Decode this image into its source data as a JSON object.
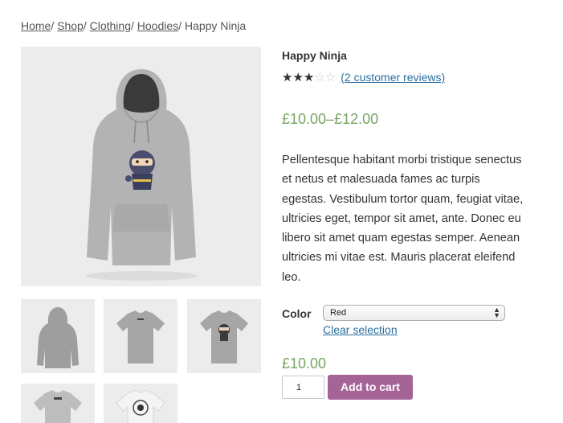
{
  "breadcrumb": {
    "items": [
      "Home",
      "Shop",
      "Clothing",
      "Hoodies"
    ],
    "separator": "/ ",
    "current": "Happy Ninja"
  },
  "product": {
    "title": "Happy Ninja",
    "rating": {
      "value": 3,
      "max": 5,
      "fraction": 0.6
    },
    "reviews_link": "(2 customer reviews)",
    "price_range": "£10.00–£12.00",
    "description": "Pellentesque habitant morbi tristique senectus et netus et malesuada fames ac turpis egestas. Vestibulum tortor quam, feugiat vitae, ultricies eget, tempor sit amet, ante. Donec eu libero sit amet quam egestas semper. Aenean ultricies mi vitae est. Mauris placerat eleifend leo.",
    "color_label": "Color",
    "color_selected": "Red",
    "clear_selection": "Clear selection",
    "variation_price": "£10.00",
    "quantity": "1",
    "add_to_cart": "Add to cart"
  },
  "gallery": {
    "main_image": "gray-hoodie-with-ninja-print",
    "thumbnails": [
      "gray-hoodie-back-view",
      "gray-tshirt-back-view",
      "gray-tshirt-with-ninja-print",
      "gray-tshirt-with-small-logo",
      "white-tshirt-with-ninja-badge"
    ]
  },
  "colors": {
    "price": "#77a464",
    "button": "#a46497",
    "link": "#2a6fa0",
    "image_bg": "#ececec"
  }
}
